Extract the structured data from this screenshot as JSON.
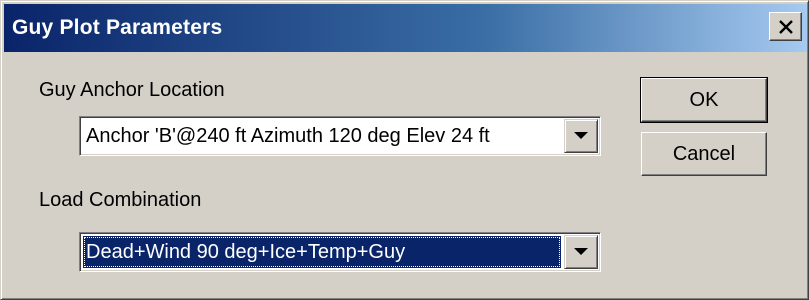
{
  "window": {
    "title": "Guy Plot Parameters"
  },
  "anchor": {
    "label": "Guy Anchor Location",
    "selected": "Anchor 'B'@240 ft Azimuth 120 deg Elev 24 ft"
  },
  "load": {
    "label": "Load Combination",
    "selected": "Dead+Wind 90 deg+Ice+Temp+Guy"
  },
  "buttons": {
    "ok": "OK",
    "cancel": "Cancel"
  },
  "colors": {
    "titlebar_start": "#0a246a",
    "titlebar_end": "#a6caf0",
    "face": "#d4d0c8",
    "selection": "#0a246a"
  },
  "icons": {
    "close": "close-icon",
    "dropdown": "chevron-down-icon"
  }
}
